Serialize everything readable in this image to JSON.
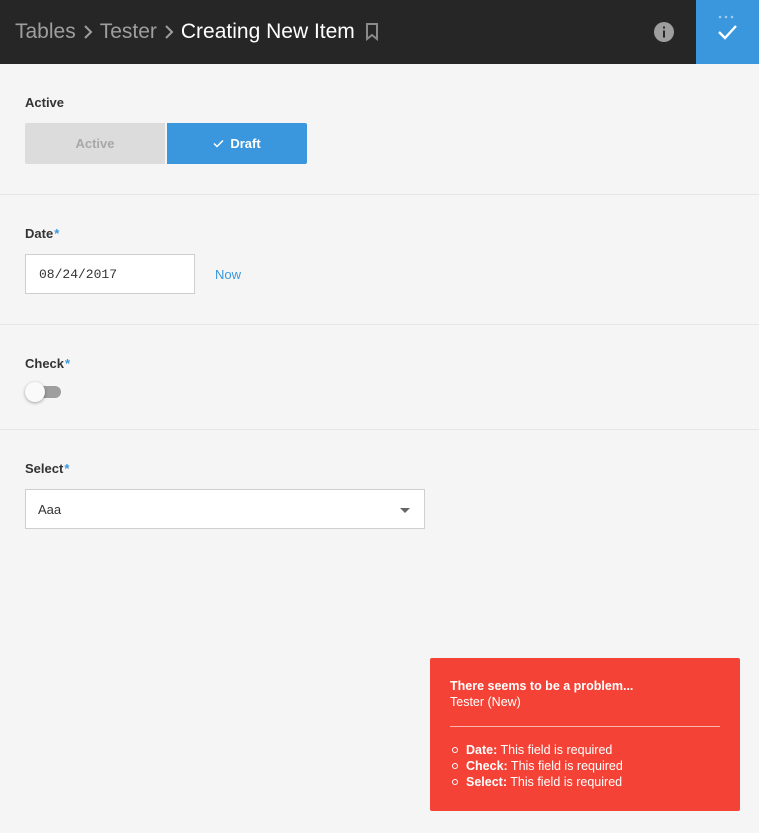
{
  "header": {
    "breadcrumb": [
      "Tables",
      "Tester",
      "Creating New Item"
    ],
    "icons": {
      "bookmark": "bookmark-icon",
      "info": "info-icon",
      "save": "check-icon",
      "more": "more-dots-icon"
    },
    "colors": {
      "background": "#262626",
      "save_button": "#3a97dd"
    }
  },
  "form": {
    "status": {
      "label": "Active",
      "options": [
        "Active",
        "Draft"
      ],
      "selected": "Draft"
    },
    "date": {
      "label": "Date",
      "required_mark": "*",
      "value": "08/24/2017",
      "now_link": "Now"
    },
    "check": {
      "label": "Check",
      "required_mark": "*",
      "checked": false
    },
    "select": {
      "label": "Select",
      "required_mark": "*",
      "value": "Aaa"
    }
  },
  "error": {
    "title": "There seems to be a problem...",
    "subtitle": "Tester (New)",
    "items": [
      {
        "field": "Date:",
        "message": " This field is required"
      },
      {
        "field": "Check:",
        "message": " This field is required"
      },
      {
        "field": "Select:",
        "message": " This field is required"
      }
    ],
    "color": "#f44336"
  },
  "accent_color": "#3a97dd"
}
